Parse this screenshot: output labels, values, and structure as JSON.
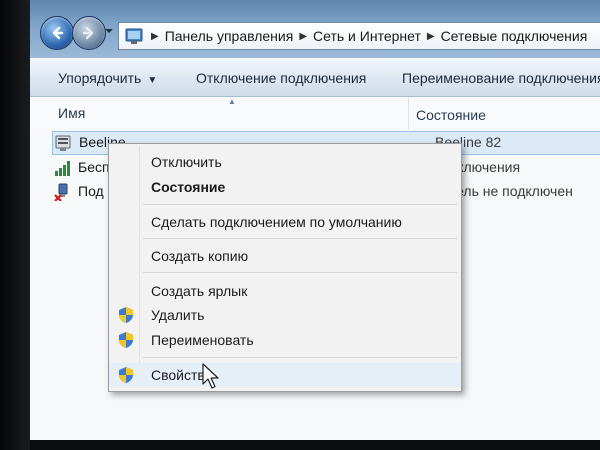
{
  "address": {
    "segments": [
      "Панель управления",
      "Сеть и Интернет",
      "Сетевые подключения"
    ]
  },
  "toolbar": {
    "organize": "Упорядочить",
    "disconnect": "Отключение подключения",
    "rename": "Переименование подключения"
  },
  "columns": {
    "name": "Имя",
    "status": "Состояние"
  },
  "connections": [
    {
      "name": "Beeline",
      "status": "Beeline 82",
      "icon": "modem-icon"
    },
    {
      "name": "Бесп",
      "status": "подключения",
      "icon": "wireless-signal-icon"
    },
    {
      "name": "Под",
      "status": "кабель не подключен",
      "icon": "ethernet-disconnected-icon"
    }
  ],
  "context_menu": {
    "items": [
      {
        "label": "Отключить",
        "shield": false,
        "bold": false
      },
      {
        "label": "Состояние",
        "shield": false,
        "bold": true
      },
      {
        "label": "Сделать подключением по умолчанию",
        "shield": false,
        "bold": false
      },
      {
        "label": "Создать копию",
        "shield": false,
        "bold": false
      },
      {
        "label": "Создать ярлык",
        "shield": false,
        "bold": false
      },
      {
        "label": "Удалить",
        "shield": true,
        "bold": false
      },
      {
        "label": "Переименовать",
        "shield": true,
        "bold": false
      },
      {
        "label": "Свойства",
        "shield": true,
        "bold": false
      }
    ]
  },
  "colors": {
    "titlebar": "#7ea3c8",
    "selection": "#dceaf8",
    "menu_bg": "#f2f2f2"
  }
}
